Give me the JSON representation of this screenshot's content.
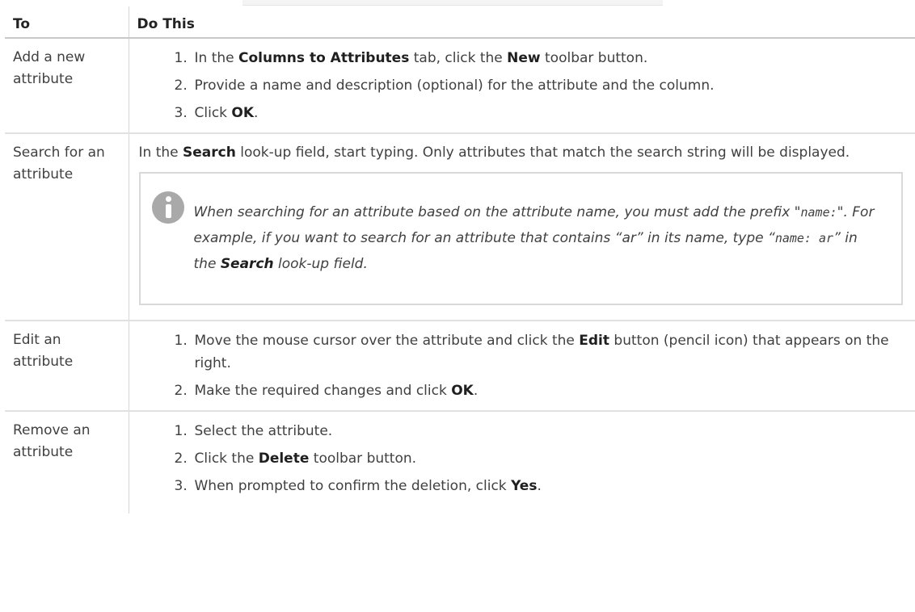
{
  "table": {
    "headers": {
      "to": "To",
      "do_this": "Do This"
    },
    "rows": {
      "add": {
        "to": "Add a new attribute",
        "steps": [
          {
            "num": "1.",
            "pre": "In the ",
            "b1": "Columns to Attributes",
            "mid": " tab, click the ",
            "b2": "New",
            "post": " toolbar button."
          },
          {
            "num": "2.",
            "text": "Provide a name and description (optional) for the attribute and the column."
          },
          {
            "num": "3.",
            "pre": "Click ",
            "b1": "OK",
            "post": "."
          }
        ]
      },
      "search": {
        "to": "Search for an attribute",
        "text_pre": "In the ",
        "text_bold": "Search",
        "text_post": " look-up field, start typing. Only attributes that match the search string will be displayed.",
        "note": {
          "p1": "When searching for an attribute based on the attribute name, you must add the prefix \"",
          "code1": "name:",
          "p2": "\". For example, if you want to search for an attribute that contains “ar” in its name, type “",
          "code2": "name: ar",
          "p3": "” in the ",
          "bold": "Search",
          "p4": " look-up field."
        }
      },
      "edit": {
        "to": "Edit an attribute",
        "steps": [
          {
            "num": "1.",
            "pre": "Move the mouse cursor over the attribute and click the ",
            "b1": "Edit",
            "post": " button (pencil icon) that appears on the right."
          },
          {
            "num": "2.",
            "pre": "Make the required changes and click ",
            "b1": "OK",
            "post": "."
          }
        ]
      },
      "remove": {
        "to": "Remove an attribute",
        "steps": [
          {
            "num": "1.",
            "text": "Select the attribute."
          },
          {
            "num": "2.",
            "pre": "Click the ",
            "b1": "Delete",
            "post": " toolbar button."
          },
          {
            "num": "3.",
            "pre": "When prompted to confirm the deletion, click ",
            "b1": "Yes",
            "post": "."
          }
        ]
      }
    }
  },
  "icons": {
    "note": "info-icon"
  }
}
